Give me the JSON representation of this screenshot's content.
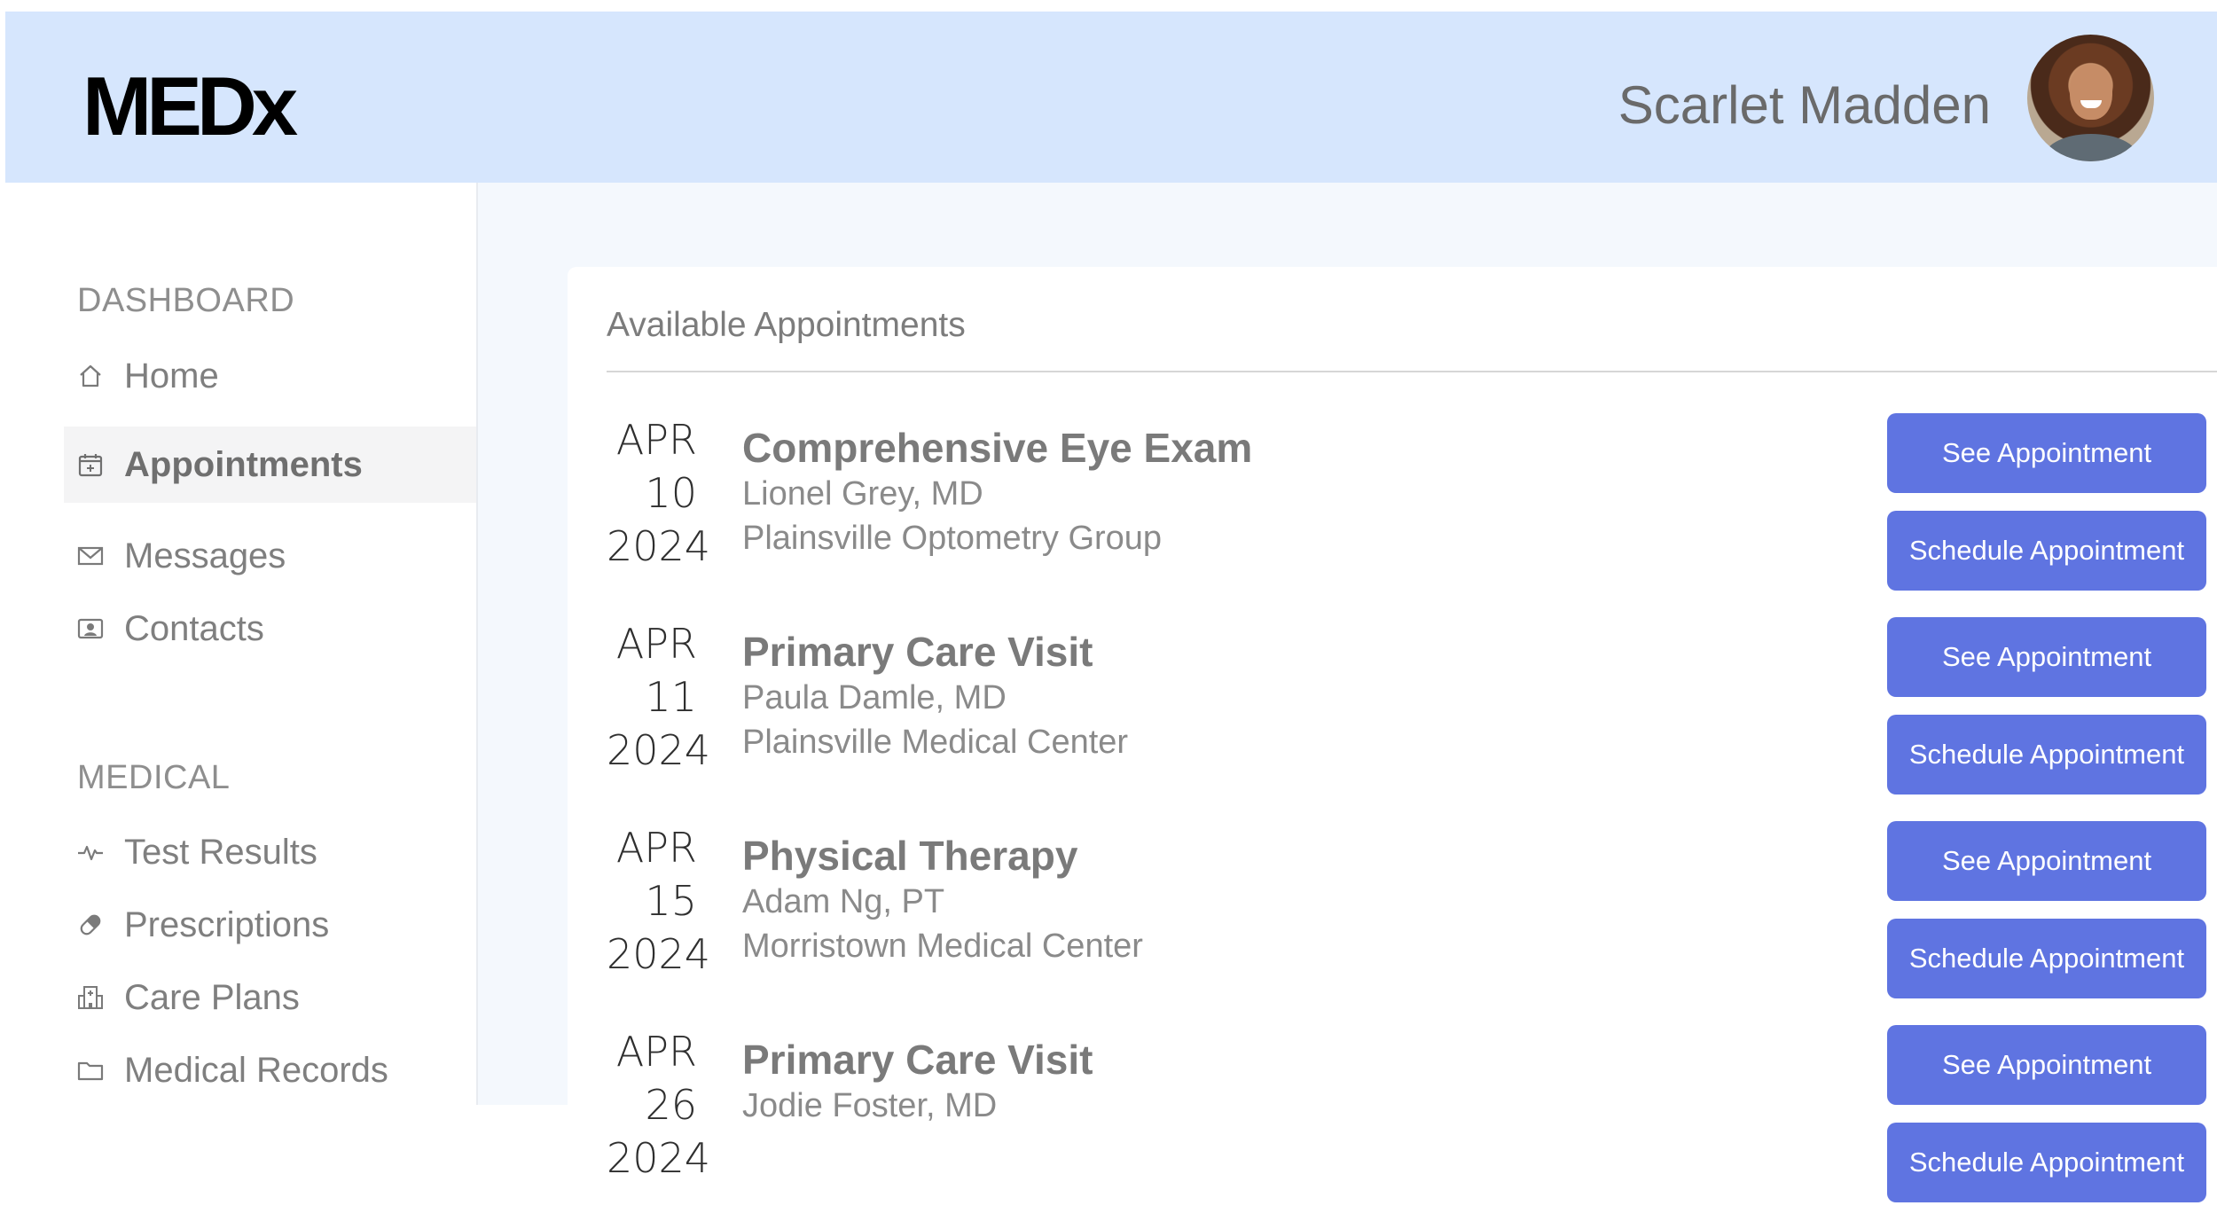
{
  "header": {
    "logo": "MEDx",
    "user_name": "Scarlet Madden"
  },
  "sidebar": {
    "sections": [
      {
        "label": "DASHBOARD",
        "items": [
          {
            "label": "Home",
            "icon": "home-icon"
          },
          {
            "label": "Appointments",
            "icon": "calendar-plus-icon",
            "active": true
          },
          {
            "label": "Messages",
            "icon": "envelope-icon"
          },
          {
            "label": "Contacts",
            "icon": "contact-card-icon"
          }
        ]
      },
      {
        "label": "MEDICAL",
        "items": [
          {
            "label": "Test Results",
            "icon": "pulse-icon"
          },
          {
            "label": "Prescriptions",
            "icon": "pill-icon"
          },
          {
            "label": "Care Plans",
            "icon": "hospital-icon"
          },
          {
            "label": "Medical Records",
            "icon": "folder-icon"
          }
        ]
      }
    ]
  },
  "main": {
    "card_title": "Available Appointments",
    "see_label": "See Appointment",
    "schedule_label": "Schedule Appointment",
    "appointments": [
      {
        "month": "APR",
        "day": "10",
        "year": "2024",
        "title": "Comprehensive Eye Exam",
        "doctor": "Lionel Grey, MD",
        "location": "Plainsville Optometry Group"
      },
      {
        "month": "APR",
        "day": "11",
        "year": "2024",
        "title": "Primary Care Visit",
        "doctor": "Paula Damle, MD",
        "location": "Plainsville Medical Center"
      },
      {
        "month": "APR",
        "day": "15",
        "year": "2024",
        "title": "Physical Therapy",
        "doctor": "Adam Ng, PT",
        "location": "Morristown Medical Center"
      },
      {
        "month": "APR",
        "day": "26",
        "year": "2024",
        "title": "Primary Care Visit",
        "doctor": "Jodie Foster, MD",
        "location": ""
      }
    ]
  },
  "colors": {
    "header_bg": "#d6e6fd",
    "main_bg": "#f4f8fd",
    "button_bg": "#5f74e1"
  }
}
